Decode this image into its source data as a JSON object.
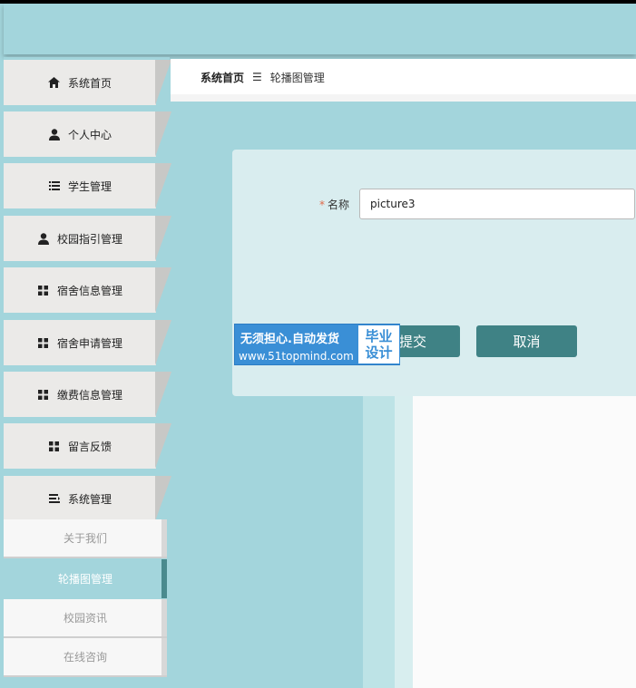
{
  "breadcrumb": {
    "home": "系统首页",
    "separator": "☰",
    "current": "轮播图管理"
  },
  "sidebar": {
    "items": [
      {
        "label": "系统首页",
        "icon": "home-icon"
      },
      {
        "label": "个人中心",
        "icon": "user-icon"
      },
      {
        "label": "学生管理",
        "icon": "list-icon"
      },
      {
        "label": "校园指引管理",
        "icon": "user-icon"
      },
      {
        "label": "宿舍信息管理",
        "icon": "grid-icon"
      },
      {
        "label": "宿舍申请管理",
        "icon": "grid-icon"
      },
      {
        "label": "缴费信息管理",
        "icon": "grid-icon"
      },
      {
        "label": "留言反馈",
        "icon": "grid-icon"
      },
      {
        "label": "系统管理",
        "icon": "settings-list-icon"
      }
    ],
    "submenu": [
      {
        "label": "关于我们",
        "active": false
      },
      {
        "label": "轮播图管理",
        "active": true
      },
      {
        "label": "校园资讯",
        "active": false
      },
      {
        "label": "在线咨询",
        "active": false
      }
    ]
  },
  "form": {
    "required_mark": "*",
    "name_label": "名称",
    "name_value": "picture3",
    "submit_label": "提交",
    "cancel_label": "取消"
  },
  "watermark": {
    "line1": "无须担心.自动发货",
    "line2": "www.51topmind.com",
    "box_line1": "毕业",
    "box_line2": "设计"
  },
  "colors": {
    "accent": "#a3d5dc",
    "button": "#3f8285",
    "required": "#e06a4b"
  }
}
